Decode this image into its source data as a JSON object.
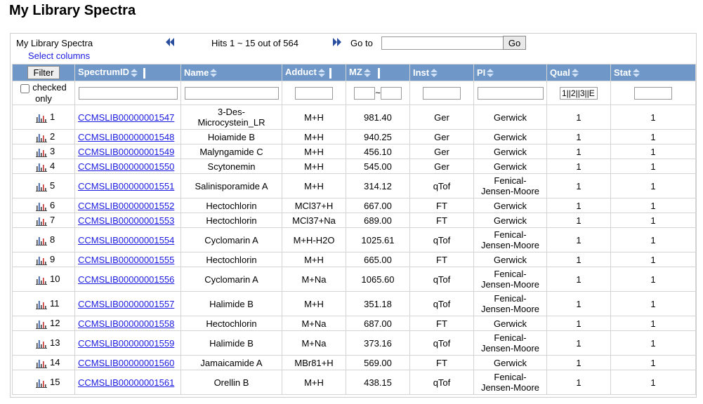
{
  "page": {
    "title": "My Library Spectra"
  },
  "toolbar": {
    "title": "My Library Spectra",
    "select_columns": "Select columns",
    "hits": "Hits 1 ~ 15 out of 564",
    "goto_label": "Go to",
    "goto_value": "",
    "go_label": "Go",
    "prev_icon": "double-chevron-left-icon",
    "next_icon": "double-chevron-right-icon"
  },
  "columns": [
    {
      "key": "filter",
      "label": "Filter"
    },
    {
      "key": "spectrum_id",
      "label": "SpectrumID"
    },
    {
      "key": "name",
      "label": "Name"
    },
    {
      "key": "adduct",
      "label": "Adduct"
    },
    {
      "key": "mz",
      "label": "MZ"
    },
    {
      "key": "inst",
      "label": "Inst"
    },
    {
      "key": "pi",
      "label": "PI"
    },
    {
      "key": "qual",
      "label": "Qual"
    },
    {
      "key": "stat",
      "label": "Stat"
    }
  ],
  "filters": {
    "checked_only_label": "checked only",
    "spectrum_id": "",
    "name": "",
    "adduct": "",
    "mz_min": "",
    "mz_sep": "~",
    "mz_max": "",
    "inst": "",
    "pi": "",
    "qual": "1||2||3||E",
    "stat": ""
  },
  "rows": [
    {
      "index": "1",
      "spectrum_id": "CCMSLIB00000001547",
      "name": "3-Des-Microcystein_LR",
      "adduct": "M+H",
      "mz": "981.40",
      "inst": "Ger",
      "pi": "Gerwick",
      "qual": "1",
      "stat": "1"
    },
    {
      "index": "2",
      "spectrum_id": "CCMSLIB00000001548",
      "name": "Hoiamide B",
      "adduct": "M+H",
      "mz": "940.25",
      "inst": "Ger",
      "pi": "Gerwick",
      "qual": "1",
      "stat": "1"
    },
    {
      "index": "3",
      "spectrum_id": "CCMSLIB00000001549",
      "name": "Malyngamide C",
      "adduct": "M+H",
      "mz": "456.10",
      "inst": "Ger",
      "pi": "Gerwick",
      "qual": "1",
      "stat": "1"
    },
    {
      "index": "4",
      "spectrum_id": "CCMSLIB00000001550",
      "name": "Scytonemin",
      "adduct": "M+H",
      "mz": "545.00",
      "inst": "Ger",
      "pi": "Gerwick",
      "qual": "1",
      "stat": "1"
    },
    {
      "index": "5",
      "spectrum_id": "CCMSLIB00000001551",
      "name": "Salinisporamide A",
      "adduct": "M+H",
      "mz": "314.12",
      "inst": "qTof",
      "pi": "Fenical-Jensen-Moore",
      "qual": "1",
      "stat": "1"
    },
    {
      "index": "6",
      "spectrum_id": "CCMSLIB00000001552",
      "name": "Hectochlorin",
      "adduct": "MCl37+H",
      "mz": "667.00",
      "inst": "FT",
      "pi": "Gerwick",
      "qual": "1",
      "stat": "1"
    },
    {
      "index": "7",
      "spectrum_id": "CCMSLIB00000001553",
      "name": "Hectochlorin",
      "adduct": "MCl37+Na",
      "mz": "689.00",
      "inst": "FT",
      "pi": "Gerwick",
      "qual": "1",
      "stat": "1"
    },
    {
      "index": "8",
      "spectrum_id": "CCMSLIB00000001554",
      "name": "Cyclomarin A",
      "adduct": "M+H-H2O",
      "mz": "1025.61",
      "inst": "qTof",
      "pi": "Fenical-Jensen-Moore",
      "qual": "1",
      "stat": "1"
    },
    {
      "index": "9",
      "spectrum_id": "CCMSLIB00000001555",
      "name": "Hectochlorin",
      "adduct": "M+H",
      "mz": "665.00",
      "inst": "FT",
      "pi": "Gerwick",
      "qual": "1",
      "stat": "1"
    },
    {
      "index": "10",
      "spectrum_id": "CCMSLIB00000001556",
      "name": "Cyclomarin A",
      "adduct": "M+Na",
      "mz": "1065.60",
      "inst": "qTof",
      "pi": "Fenical-Jensen-Moore",
      "qual": "1",
      "stat": "1"
    },
    {
      "index": "11",
      "spectrum_id": "CCMSLIB00000001557",
      "name": "Halimide B",
      "adduct": "M+H",
      "mz": "351.18",
      "inst": "qTof",
      "pi": "Fenical-Jensen-Moore",
      "qual": "1",
      "stat": "1"
    },
    {
      "index": "12",
      "spectrum_id": "CCMSLIB00000001558",
      "name": "Hectochlorin",
      "adduct": "M+Na",
      "mz": "687.00",
      "inst": "FT",
      "pi": "Gerwick",
      "qual": "1",
      "stat": "1"
    },
    {
      "index": "13",
      "spectrum_id": "CCMSLIB00000001559",
      "name": "Halimide B",
      "adduct": "M+Na",
      "mz": "373.16",
      "inst": "qTof",
      "pi": "Fenical-Jensen-Moore",
      "qual": "1",
      "stat": "1"
    },
    {
      "index": "14",
      "spectrum_id": "CCMSLIB00000001560",
      "name": "Jamaicamide A",
      "adduct": "MBr81+H",
      "mz": "569.00",
      "inst": "FT",
      "pi": "Gerwick",
      "qual": "1",
      "stat": "1"
    },
    {
      "index": "15",
      "spectrum_id": "CCMSLIB00000001561",
      "name": "Orellin B",
      "adduct": "M+H",
      "mz": "438.15",
      "inst": "qTof",
      "pi": "Fenical-Jensen-Moore",
      "qual": "1",
      "stat": "1"
    }
  ],
  "icons": {
    "spectrum": "spectrum-chart-icon"
  },
  "colors": {
    "header_bg": "#6f98c9",
    "link": "#1a1ae0",
    "border": "#d4d4d4"
  }
}
